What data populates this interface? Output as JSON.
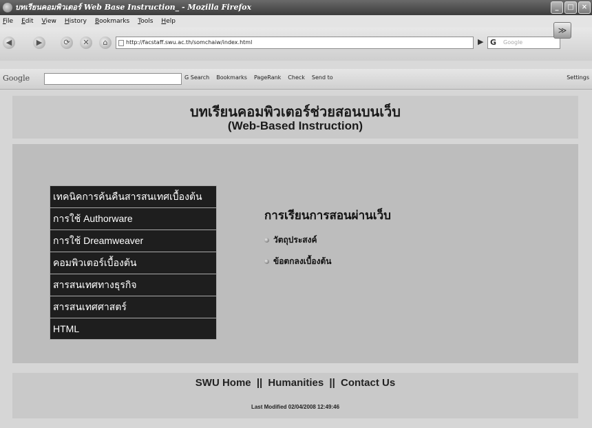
{
  "window": {
    "title": "บทเรียนคอมพิวเตอร์ Web Base Instruction_ - Mozilla Firefox",
    "controls": [
      "_",
      "□",
      "×"
    ]
  },
  "menu": [
    "File",
    "Edit",
    "View",
    "History",
    "Bookmarks",
    "Tools",
    "Help"
  ],
  "nav": {
    "back": "◀",
    "forward": "▶",
    "reload": "⟳",
    "stop": "✕",
    "home": "⌂",
    "url": "http://facstaff.swu.ac.th/somchaiw/index.html",
    "go": "▶",
    "search_placeholder": "Google",
    "grab_icon": "≫"
  },
  "google_toolbar": {
    "logo": "Google",
    "search_label": "G Search",
    "bookmarks": "Bookmarks",
    "pagerank": "PageRank",
    "check": "Check",
    "send_to": "Send to",
    "settings": "Settings"
  },
  "page": {
    "title": "บทเรียนคอมพิวเตอร์ช่วยสอนบนเว็บ",
    "subtitle": "(Web-Based Instruction)",
    "menu_items": [
      "เทคนิคการค้นคืนสารสนเทศเบื้องต้น",
      "การใช้ Authorware",
      "การใช้ Dreamweaver",
      "คอมพิวเตอร์เบื้องต้น",
      "สารสนเทศทางธุรกิจ",
      "สารสนเทศศาสตร์",
      "HTML"
    ],
    "content_heading": "การเรียนการสอนผ่านเว็บ",
    "content_links": [
      "วัตถุประสงค์",
      "ข้อตกลงเบื้องต้น"
    ],
    "footer": {
      "home": "SWU Home",
      "humanities": "Humanities",
      "contact": "Contact Us",
      "separator": "||",
      "last_modified": "Last Modified 02/04/2008 12:49:46"
    }
  }
}
